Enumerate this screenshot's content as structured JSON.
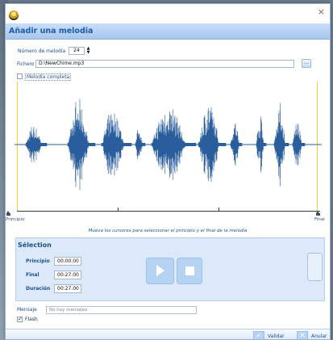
{
  "window": {
    "title": "Añadir una melodia",
    "close_symbol": "×"
  },
  "form": {
    "melody_number_label": "Número de melodía",
    "melody_number_value": "24",
    "file_label": "Fichero",
    "file_value": "D:\\NewChime.mp3",
    "browse_label": "...",
    "full_melody_label": "Melodía completa",
    "full_melody_checked": false
  },
  "timeline": {
    "start_label": "Principio",
    "end_label": "Final"
  },
  "hint": "Mueva los cursores para seleccionar el principio y el final de la melodía",
  "selection": {
    "title": "Sélection",
    "rows": [
      {
        "label": "Principio",
        "value": "00:00.00"
      },
      {
        "label": "Final",
        "value": "00:27.00"
      },
      {
        "label": "Duración",
        "value": "00:27.00"
      }
    ]
  },
  "message": {
    "label": "Mensaje",
    "placeholder": "No hay mensajes"
  },
  "flash": {
    "label": "Flash",
    "checked": true
  },
  "buttons": {
    "validate": "Validar",
    "cancel": "Anular"
  },
  "colors": {
    "accent": "#1d5ba8",
    "waveform": "#2a5d9c",
    "cursor": "#f2d13a",
    "header_bg": "#b7d2f3"
  },
  "icons": {
    "app": "app-logo-icon",
    "close": "close-icon",
    "play": "play-icon",
    "stop": "stop-icon",
    "validate": "check-icon",
    "cancel": "x-icon"
  }
}
